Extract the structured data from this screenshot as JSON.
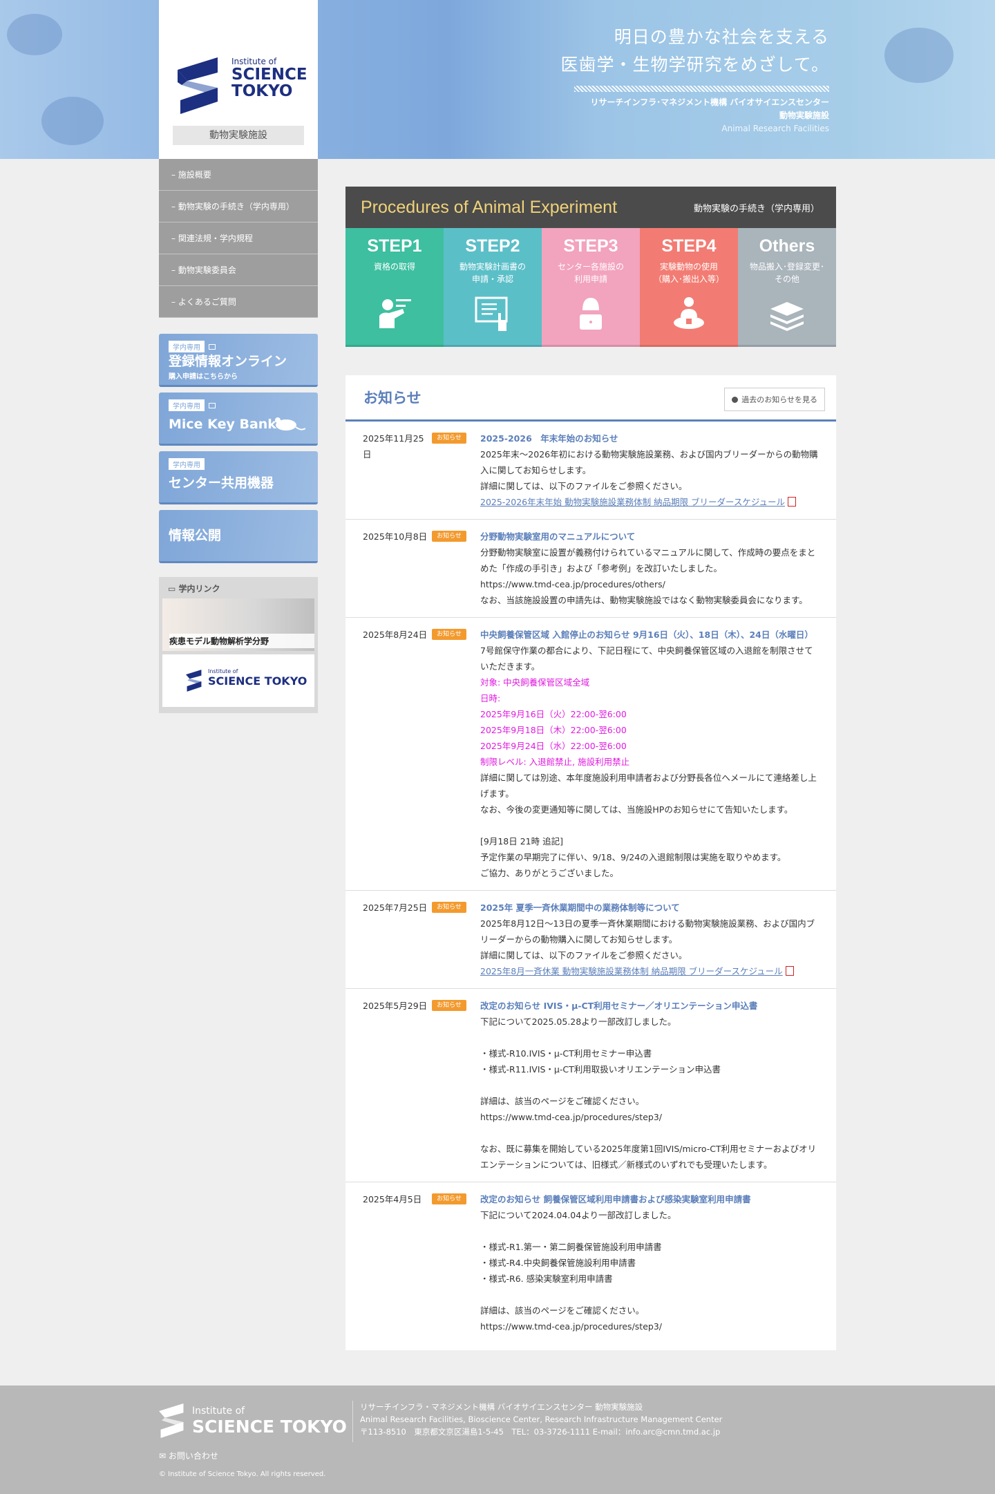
{
  "hero": {
    "tagline_1": "明日の豊かな社会を支える",
    "tagline_2": "医歯学・生物学研究をめざして。",
    "org": "リサーチインフラ･マネジメント機構 バイオサイエンスセンター",
    "facility": "動物実験施設",
    "facility_en": "Animal Research Facilities"
  },
  "logo": {
    "small": "Institute of",
    "line1": "SCIENCE",
    "line2": "TOKYO",
    "facility": "動物実験施設"
  },
  "nav": [
    "施設概要",
    "動物実験の手続き（学内専用）",
    "関連法規・学内規程",
    "動物実験委員会",
    "よくあるご質問"
  ],
  "banners": [
    {
      "tag": "学内専用",
      "title": "登録情報オンライン",
      "sub": "購入申請はこちらから"
    },
    {
      "tag": "学内専用",
      "title": "Mice Key Bank",
      "sub": ""
    },
    {
      "tag": "学内専用",
      "title": "センター共用機器",
      "sub": ""
    },
    {
      "tag": "",
      "title": "情報公開",
      "sub": ""
    }
  ],
  "links": {
    "heading": "学内リンク",
    "card1": "疾患モデル動物解析学分野",
    "card2_small": "Institute of",
    "card2_big": "SCIENCE TOKYO"
  },
  "procedures": {
    "title": "Procedures of Animal Experiment",
    "subtitle": "動物実験の手続き（学内専用）",
    "steps": [
      {
        "name": "STEP1",
        "desc": "資格の取得",
        "color": "#3dbfa0",
        "icon": "teacher-icon"
      },
      {
        "name": "STEP2",
        "desc": "動物実験計画書の\n申請・承認",
        "color": "#5bbfc8",
        "icon": "tablet-touch-icon"
      },
      {
        "name": "STEP3",
        "desc": "センター各施設の\n利用申請",
        "color": "#f2a3bd",
        "icon": "person-laptop-icon"
      },
      {
        "name": "STEP4",
        "desc": "実験動物の使用\n（購入･搬出入等）",
        "color": "#f27c73",
        "icon": "person-desk-icon"
      },
      {
        "name": "Others",
        "desc": "物品搬入･登録変更･\nその他",
        "color": "#a9b4bb",
        "icon": "books-icon"
      }
    ]
  },
  "news": {
    "heading": "お知らせ",
    "more": "過去のお知らせを見る",
    "items": [
      {
        "date": "2025年11月25日",
        "badge": "お知らせ",
        "title": "2025-2026　年末年始のお知らせ",
        "lines": [
          {
            "t": "text",
            "v": "2025年末～2026年初における動物実験施設業務、および国内ブリーダーからの動物購入に関してお知らせします。"
          },
          {
            "t": "text",
            "v": "詳細に関しては、以下のファイルをご参照ください。"
          },
          {
            "t": "link",
            "v": "2025-2026年末年始 動物実験施設業務体制 納品期限 ブリーダースケジュール"
          }
        ]
      },
      {
        "date": "2025年10月8日",
        "badge": "お知らせ",
        "title": "分野動物実験室用のマニュアルについて",
        "lines": [
          {
            "t": "text",
            "v": "分野動物実験室に設置が義務付けられているマニュアルに関して、作成時の要点をまとめた「作成の手引き」および「参考例」を改訂いたしました。"
          },
          {
            "t": "text",
            "v": "https://www.tmd-cea.jp/procedures/others/"
          },
          {
            "t": "text",
            "v": "なお、当該施設設置の申請先は、動物実験施設ではなく動物実験委員会になります。"
          }
        ]
      },
      {
        "date": "2025年8月24日",
        "badge": "お知らせ",
        "title": "中央飼養保管区域 入館停止のお知らせ 9月16日（火）、18日（木）、24日（水曜日）",
        "lines": [
          {
            "t": "text",
            "v": "7号館保守作業の都合により、下記日程にて、中央飼養保管区域の入退館を制限させていただきます。"
          },
          {
            "t": "pink",
            "v": "対象: 中央飼養保管区域全域"
          },
          {
            "t": "pink",
            "v": "日時:"
          },
          {
            "t": "pink",
            "v": "2025年9月16日（火）22:00-翌6:00"
          },
          {
            "t": "pink",
            "v": "2025年9月18日（木）22:00-翌6:00"
          },
          {
            "t": "pink",
            "v": "2025年9月24日（水）22:00-翌6:00"
          },
          {
            "t": "pink",
            "v": "制限レベル: 入退館禁止, 施設利用禁止"
          },
          {
            "t": "text",
            "v": "詳細に関しては別途、本年度施設利用申請者および分野長各位へメールにて連絡差し上げます。"
          },
          {
            "t": "text",
            "v": "なお、今後の変更通知等に関しては、当施設HPのお知らせにて告知いたします。"
          },
          {
            "t": "blank",
            "v": ""
          },
          {
            "t": "text",
            "v": "[9月18日 21時 追記]"
          },
          {
            "t": "text",
            "v": "予定作業の早期完了に伴い、9/18、9/24の入退館制限は実施を取りやめます。"
          },
          {
            "t": "text",
            "v": "ご協力、ありがとうございました。"
          }
        ]
      },
      {
        "date": "2025年7月25日",
        "badge": "お知らせ",
        "title": "2025年 夏季一斉休業期間中の業務体制等について",
        "lines": [
          {
            "t": "text",
            "v": "2025年8月12日～13日の夏季一斉休業期間における動物実験施設業務、および国内ブリーダーからの動物購入に関してお知らせします。"
          },
          {
            "t": "text",
            "v": "詳細に関しては、以下のファイルをご参照ください。"
          },
          {
            "t": "link",
            "v": "2025年8月一斉休業 動物実験施設業務体制 納品期限 ブリーダースケジュール"
          }
        ]
      },
      {
        "date": "2025年5月29日",
        "badge": "お知らせ",
        "title": "改定のお知らせ IVIS・μ-CT利用セミナー／オリエンテーション申込書",
        "lines": [
          {
            "t": "text",
            "v": "下記について2025.05.28より一部改訂しました。"
          },
          {
            "t": "blank",
            "v": ""
          },
          {
            "t": "text",
            "v": "・様式-R10.IVIS・μ-CT利用セミナー申込書"
          },
          {
            "t": "text",
            "v": "・様式-R11.IVIS・μ-CT利用取扱いオリエンテーション申込書"
          },
          {
            "t": "blank",
            "v": ""
          },
          {
            "t": "text",
            "v": "詳細は、該当のページをご確認ください。"
          },
          {
            "t": "text",
            "v": "https://www.tmd-cea.jp/procedures/step3/"
          },
          {
            "t": "blank",
            "v": ""
          },
          {
            "t": "text",
            "v": "なお、既に募集を開始している2025年度第1回IVIS/micro-CT利用セミナーおよびオリエンテーションについては、旧様式／新様式のいずれでも受理いたします。"
          }
        ]
      },
      {
        "date": "2025年4月5日",
        "badge": "お知らせ",
        "title": "改定のお知らせ 飼養保管区域利用申請書および感染実験室利用申請書",
        "lines": [
          {
            "t": "text",
            "v": "下記について2024.04.04より一部改訂しました。"
          },
          {
            "t": "blank",
            "v": ""
          },
          {
            "t": "text",
            "v": "・様式-R1.第一・第二飼養保管施設利用申請書"
          },
          {
            "t": "text",
            "v": "・様式-R4.中央飼養保管施設利用申請書"
          },
          {
            "t": "text",
            "v": "・様式-R6. 感染実験室利用申請書"
          },
          {
            "t": "blank",
            "v": ""
          },
          {
            "t": "text",
            "v": "詳細は、該当のページをご確認ください。"
          },
          {
            "t": "text",
            "v": "https://www.tmd-cea.jp/procedures/step3/"
          }
        ]
      }
    ]
  },
  "footer": {
    "logo_small": "Institute of",
    "logo_big": "SCIENCE TOKYO",
    "org_ja": "リサーチインフラ・マネジメント機構 バイオサイエンスセンター 動物実験施設",
    "org_en": "Animal Research Facilities, Bioscience Center, Research Infrastructure Management Center",
    "address": "〒113-8510　東京都文京区湯島1-5-45　TEL：03-3726-1111 E-mail：info.arc@cmn.tmd.ac.jp",
    "contact": "お問い合わせ",
    "copyright": "© Institute of Science Tokyo. All rights reserved."
  }
}
